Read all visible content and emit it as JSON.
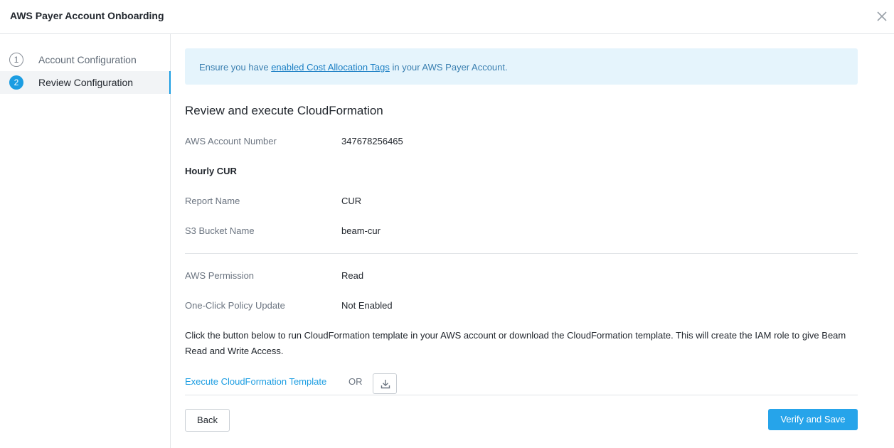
{
  "header": {
    "title": "AWS Payer Account Onboarding",
    "close_icon": "close-icon"
  },
  "sidebar": {
    "steps": [
      {
        "number": "1",
        "label": "Account Configuration",
        "active": false
      },
      {
        "number": "2",
        "label": "Review Configuration",
        "active": true
      }
    ]
  },
  "banner": {
    "text_before": "Ensure you have ",
    "link_text": "enabled Cost Allocation Tags",
    "text_after": " in your AWS Payer Account."
  },
  "review": {
    "title": "Review and execute CloudFormation",
    "account_number_label": "AWS Account Number",
    "account_number_value": "347678256465",
    "hourly_cur_title": "Hourly CUR",
    "report_name_label": "Report Name",
    "report_name_value": "CUR",
    "bucket_label": "S3 Bucket Name",
    "bucket_value": "beam-cur",
    "permission_label": "AWS Permission",
    "permission_value": "Read",
    "policy_label": "One-Click Policy Update",
    "policy_value": "Not Enabled",
    "description": "Click the button below to run CloudFormation template in your AWS account or download the CloudFormation template. This will create the IAM role to give Beam Read and Write Access.",
    "execute_link": "Execute CloudFormation Template",
    "or_text": "OR",
    "download_icon": "download-icon"
  },
  "footer": {
    "back_label": "Back",
    "save_label": "Verify and Save"
  },
  "colors": {
    "accent": "#1b9de2",
    "primary_button": "#26a4ea",
    "banner_bg": "#e5f4fc"
  }
}
